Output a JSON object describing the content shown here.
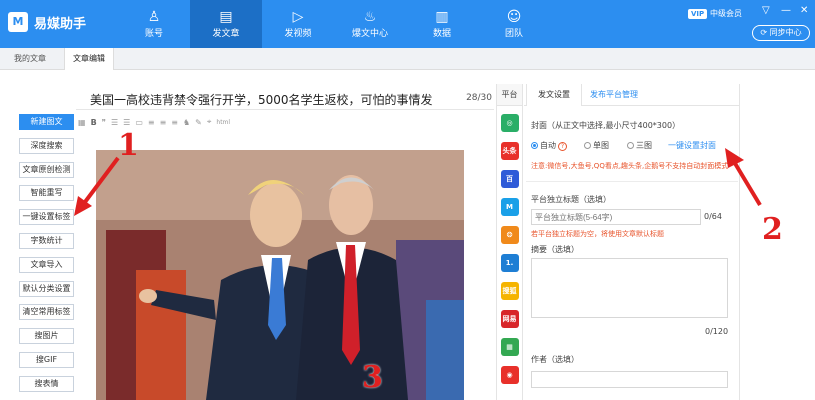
{
  "app": {
    "name": "易媒助手",
    "logo_glyph": "M"
  },
  "nav": [
    {
      "label": "账号",
      "icon": "user-icon",
      "glyph": "♙"
    },
    {
      "label": "发文章",
      "icon": "document-icon",
      "glyph": "▤"
    },
    {
      "label": "发视频",
      "icon": "play-icon",
      "glyph": "▷"
    },
    {
      "label": "爆文中心",
      "icon": "fire-icon",
      "glyph": "♨"
    },
    {
      "label": "数据",
      "icon": "bar-chart-icon",
      "glyph": "▥"
    },
    {
      "label": "团队",
      "icon": "team-icon",
      "glyph": "☺"
    }
  ],
  "header": {
    "vip": "VIP",
    "member_level": "中级会员",
    "min": "—",
    "dropdown": "▽",
    "close": "✕",
    "sync": "同步中心"
  },
  "tabs": {
    "my_articles": "我的文章",
    "article_edit": "文章编辑"
  },
  "sidebar_buttons": [
    "新建图文",
    "深度搜索",
    "文章原创检测",
    "智能重写",
    "一键设置标签",
    "字数统计",
    "文章导入",
    "默认分类设置",
    "清空常用标签",
    "搜图片",
    "搜GIF",
    "搜表情"
  ],
  "editor": {
    "title": "美国一高校违背禁令强行开学，5000名学生返校，可怕的事情发",
    "char_count": "28/30",
    "toolbar": [
      "▦",
      "B",
      "❞",
      "☰",
      "☰",
      "▭",
      "≡",
      "≡",
      "≡",
      "♞",
      "✎",
      "⌖",
      "html"
    ]
  },
  "platform_column": {
    "header": "平台"
  },
  "platforms": [
    {
      "name": "wechat-icon",
      "label": "◎",
      "color": "#2aae67"
    },
    {
      "name": "toutiao-icon",
      "label": "头条",
      "color": "#e8302a"
    },
    {
      "name": "baijia-icon",
      "label": "百",
      "color": "#2f5bd8"
    },
    {
      "name": "dayu-icon",
      "label": "M",
      "color": "#1aa0e8"
    },
    {
      "name": "weibo-icon",
      "label": "❂",
      "color": "#f08a1b"
    },
    {
      "name": "yidian-icon",
      "label": "1.",
      "color": "#1e7ed4"
    },
    {
      "name": "sohu-icon",
      "label": "搜狐",
      "color": "#f5b400"
    },
    {
      "name": "netease-icon",
      "label": "网易",
      "color": "#d8262a"
    },
    {
      "name": "qq-icon",
      "label": "▦",
      "color": "#33a852"
    },
    {
      "name": "sina-icon",
      "label": "◉",
      "color": "#e8302a"
    }
  ],
  "panel": {
    "tab_settings": "发文设置",
    "tab_manage": "发布平台管理",
    "cover_label": "封面（从正文中选择,最小尺寸400*300）",
    "cover_options": [
      "自动",
      "单图",
      "三图"
    ],
    "cover_link": "一键设置封面",
    "cover_warning": "注意:微信号,大鱼号,QQ看点,趣头条,企鹅号不支持自动封面模式",
    "standalone_title_label": "平台独立标题（选填）",
    "standalone_title_placeholder": "平台独立标题(5-64字)",
    "standalone_title_count": "0/64",
    "standalone_title_hint": "若平台独立标题为空，将使用文章默认标题",
    "summary_label": "摘要（选填）",
    "summary_count": "0/120",
    "author_label": "作者（选填）"
  },
  "annotations": [
    "1",
    "2",
    "3"
  ]
}
